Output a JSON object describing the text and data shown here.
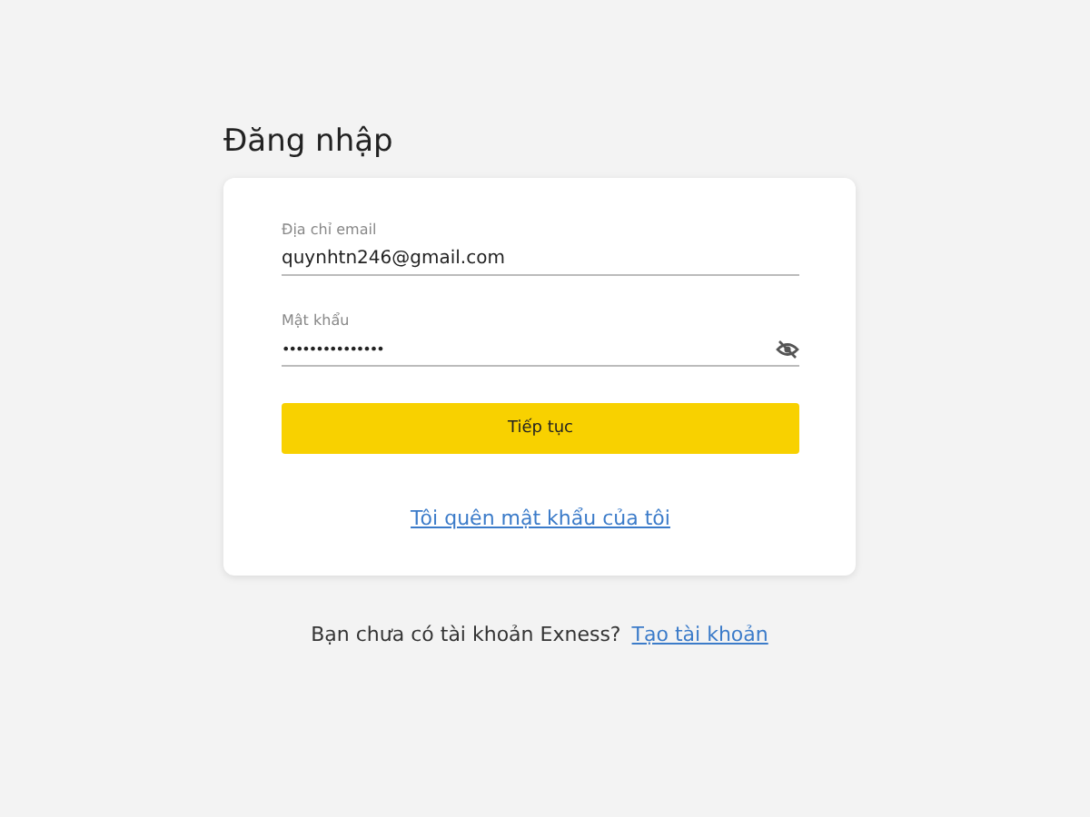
{
  "heading": "Đăng nhập",
  "fields": [
    {
      "label": "Địa chỉ email",
      "value": "quynhtn246@gmail.com",
      "kind": "text"
    },
    {
      "label": "Mật khẩu",
      "value": "•••••••••••••••",
      "kind": "password"
    }
  ],
  "submit": "Tiếp tục",
  "forgot_link": "Tôi quên mật khẩu của tôi",
  "signup": {
    "text": "Bạn chưa có tài khoản Exness?",
    "link": "Tạo tài khoản"
  }
}
